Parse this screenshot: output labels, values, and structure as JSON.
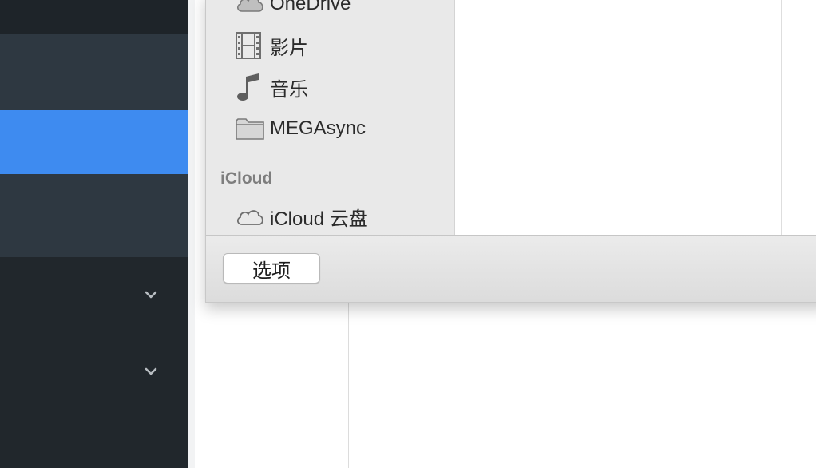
{
  "app_sidebar": {
    "chevrons": [
      "chevron-down-icon",
      "chevron-down-icon"
    ],
    "active_color": "#3e8bf0"
  },
  "dialog": {
    "sidebar": {
      "items": [
        {
          "label": "OneDrive",
          "icon": "cloud-icon"
        },
        {
          "label": "影片",
          "icon": "film-icon"
        },
        {
          "label": "音乐",
          "icon": "music-note-icon"
        },
        {
          "label": "MEGAsync",
          "icon": "folder-icon"
        }
      ],
      "section": "iCloud",
      "icloud_items": [
        {
          "label": "iCloud 云盘",
          "icon": "icloud-icon"
        }
      ]
    },
    "footer": {
      "options_label": "选项"
    }
  }
}
